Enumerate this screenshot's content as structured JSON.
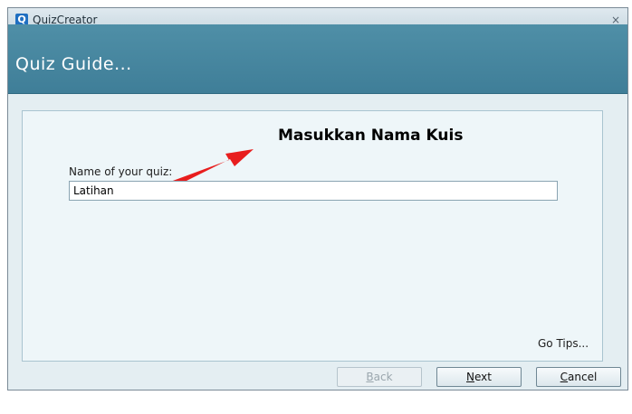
{
  "window": {
    "app_icon_letter": "Q",
    "title": "QuizCreator",
    "close_glyph": "×"
  },
  "header": {
    "title": "Quiz Guide..."
  },
  "annotation": {
    "text": "Masukkan Nama Kuis",
    "arrow_color": "#e81e1e"
  },
  "form": {
    "label": "Name of your quiz:",
    "value": "Latihan"
  },
  "links": {
    "go_tips": "Go Tips..."
  },
  "buttons": {
    "back": {
      "mnemonic": "B",
      "rest": "ack",
      "enabled": false
    },
    "next": {
      "mnemonic": "N",
      "rest": "ext",
      "enabled": true
    },
    "cancel": {
      "mnemonic": "C",
      "rest": "ancel",
      "enabled": true
    }
  },
  "colors": {
    "header_band": "#4a89a2",
    "panel": "#eef6f9",
    "window_bg": "#e4eef2"
  }
}
